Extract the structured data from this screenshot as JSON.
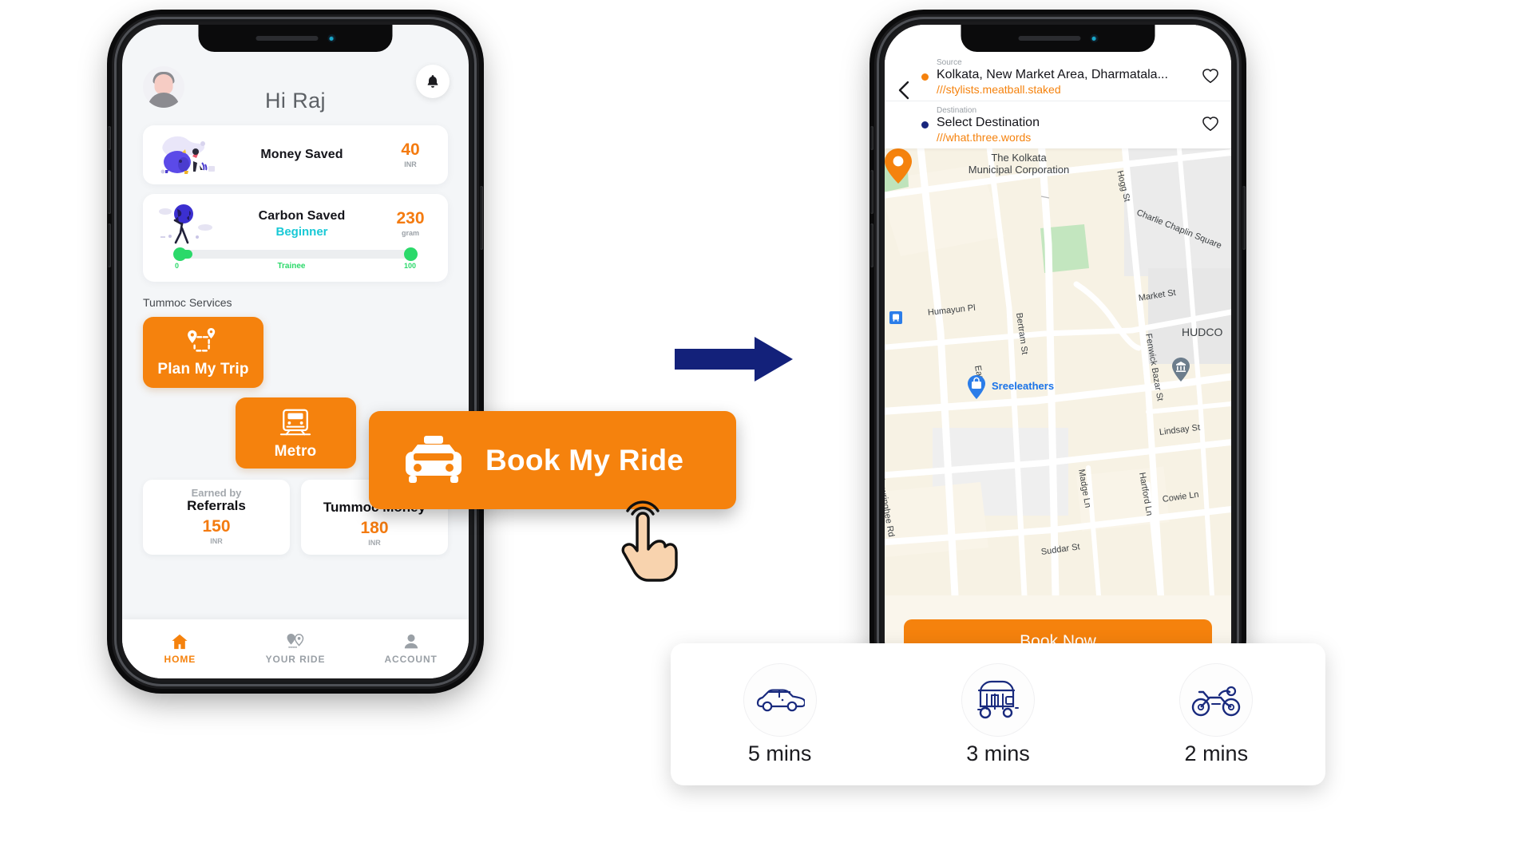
{
  "left_phone": {
    "name": "tummoc-home-screen",
    "greeting": "Hi Raj",
    "avatar_alt": "user-avatar",
    "bell_icon": "bell-icon",
    "stats": [
      {
        "title": "Money Saved",
        "subtitle": "",
        "value": "40",
        "unit": "INR",
        "illustration": "piggy-bank-illustration"
      },
      {
        "title": "Carbon Saved",
        "subtitle": "Beginner",
        "value": "230",
        "unit": "gram",
        "illustration": "globe-person-illustration"
      }
    ],
    "progress": {
      "min_label": "0",
      "mid_label": "Trainee",
      "max_label": "100",
      "fill_percent": 4,
      "color": "#2bd96a"
    },
    "services_label": "Tummoc Services",
    "tiles": [
      {
        "label": "Plan My Trip",
        "icon": "route-pin-icon"
      },
      {
        "label": "Metro",
        "icon": "metro-train-icon"
      }
    ],
    "money_cards": [
      {
        "sub": "Earned by",
        "title": "Referrals",
        "value": "150",
        "unit": "INR"
      },
      {
        "sub": "",
        "title": "Tummoc Money",
        "value": "180",
        "unit": "INR"
      }
    ],
    "bottom_nav": [
      {
        "label": "HOME",
        "icon": "home-icon",
        "active": true
      },
      {
        "label": "YOUR RIDE",
        "icon": "ride-pins-icon",
        "active": false
      },
      {
        "label": "ACCOUNT",
        "icon": "person-icon",
        "active": false
      }
    ]
  },
  "overlay": {
    "book_my_ride_label": "Book My Ride",
    "book_my_ride_icon": "taxi-icon",
    "tap_cursor_icon": "tap-hand-icon",
    "arrow_icon": "right-arrow-icon",
    "accent_orange": "#f5820d",
    "arrow_navy": "#13217a"
  },
  "right_phone": {
    "name": "book-ride-screen",
    "back_icon": "back-chevron-icon",
    "source": {
      "label": "Source",
      "value": "Kolkata, New Market Area, Dharmatala...",
      "what3words": "///stylists.meatball.staked",
      "dot_color": "#f5820d",
      "favorite_icon": "heart-outline-icon"
    },
    "destination": {
      "label": "Destination",
      "value": "Select Destination",
      "what3words": "///what.three.words",
      "dot_color": "#19267d",
      "favorite_icon": "heart-outline-icon"
    },
    "map": {
      "pin_icon": "location-pin-icon",
      "labels": [
        "The Kolkata",
        "Municipal Corporation",
        "Hogg St",
        "Charlie Chaplin Square",
        "Market St",
        "Humayun Pl",
        "Bertram St",
        "Eat St",
        "Sreeleathers",
        "Fenwick Bazar St",
        "HUDCO",
        "Lindsay St",
        "Madge Ln",
        "Hartford Ln",
        "Cowie Ln",
        "Suddar St",
        "Chowringhee Rd"
      ],
      "poi_markers": [
        "bus-stop-icon",
        "bank-icon",
        "shop-pin-icon"
      ]
    },
    "vehicles": [
      {
        "eta": "5 mins",
        "icon": "car-icon"
      },
      {
        "eta": "3 mins",
        "icon": "auto-rickshaw-icon"
      },
      {
        "eta": "2 mins",
        "icon": "motorbike-icon"
      }
    ],
    "book_now_label": "Book Now"
  }
}
